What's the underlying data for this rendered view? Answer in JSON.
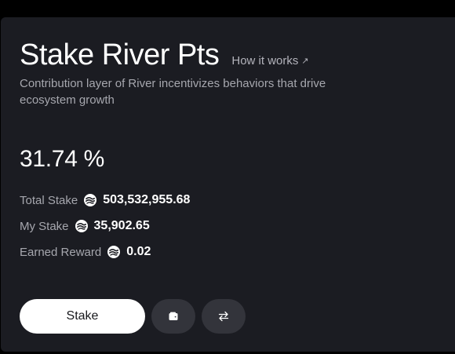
{
  "header": {
    "title": "Stake River Pts",
    "how_link": "How it works",
    "how_arrow": "↗"
  },
  "subtitle": "Contribution layer of River incentivizes behaviors that drive ecosystem growth",
  "apy": "31.74 %",
  "stats": [
    {
      "label": "Total Stake",
      "value": "503,532,955.68",
      "icon": "river-token-icon"
    },
    {
      "label": "My Stake",
      "value": "35,902.65",
      "icon": "river-token-icon"
    },
    {
      "label": "Earned Reward",
      "value": "0.02",
      "icon": "river-token-icon"
    }
  ],
  "actions": {
    "stake_label": "Stake",
    "wallet_icon": "wallet-icon",
    "swap_icon": "swap-arrows-icon"
  },
  "colors": {
    "card_bg": "#1b1c22",
    "muted_text": "#a6a7ae",
    "icon_button_bg": "#33343b",
    "primary_button_bg": "#ffffff"
  }
}
